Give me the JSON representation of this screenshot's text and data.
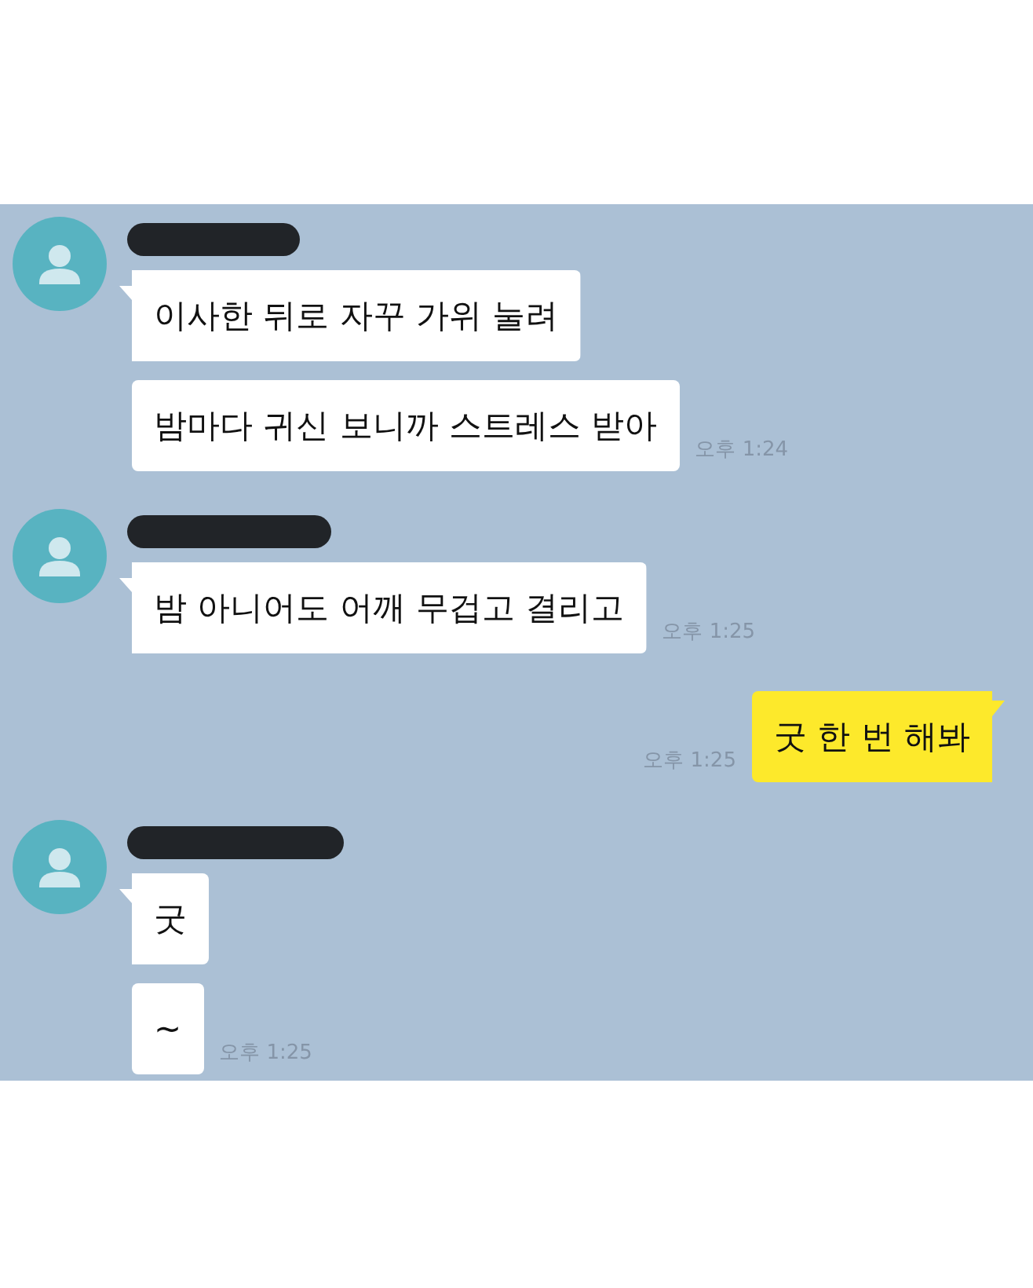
{
  "chat": {
    "groups": [
      {
        "kind": "received",
        "name_redacted": true,
        "bubbles": [
          {
            "text": "이사한 뒤로 자꾸 가위 눌려"
          },
          {
            "text": "밤마다 귀신 보니까 스트레스 받아",
            "time": "오후 1:24"
          }
        ]
      },
      {
        "kind": "received",
        "name_redacted": true,
        "bubbles": [
          {
            "text": "밤 아니어도 어깨 무겁고 결리고",
            "time": "오후 1:25"
          }
        ]
      },
      {
        "kind": "sent",
        "bubbles": [
          {
            "text": "굿 한 번 해봐",
            "time": "오후 1:25"
          }
        ]
      },
      {
        "kind": "received",
        "name_redacted": true,
        "bubbles": [
          {
            "text": "굿"
          },
          {
            "text": "~",
            "time": "오후 1:25"
          }
        ]
      }
    ]
  }
}
